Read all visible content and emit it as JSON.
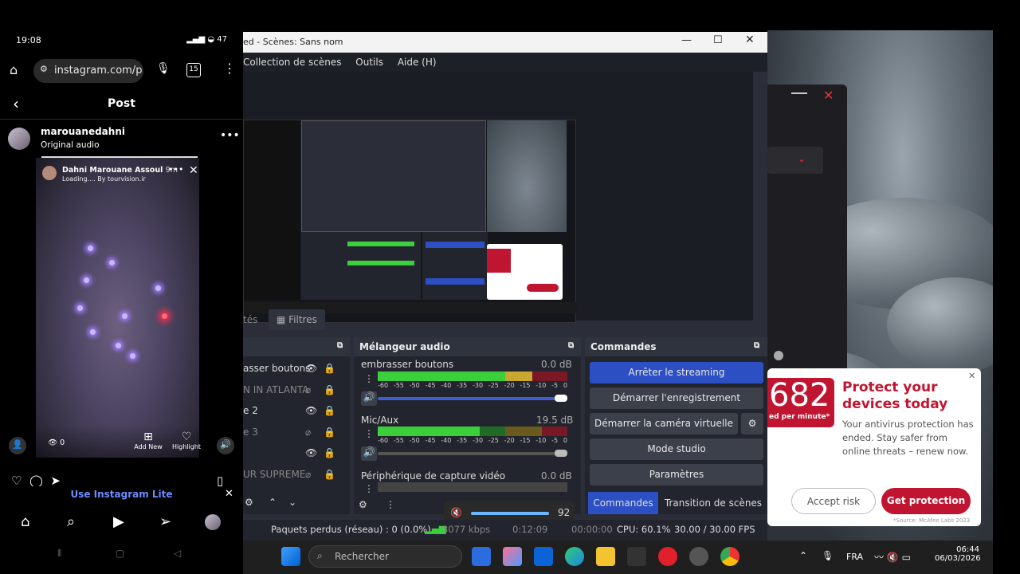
{
  "phone": {
    "time": "19:08",
    "url": "instagram.com/p.",
    "tab_count": "15",
    "page_title": "Post",
    "username": "marouanedahni",
    "audio": "Original audio",
    "story_user": "Dahni Marouane Assoul",
    "story_time": "9m",
    "story_sub": "Loading.... By tourvision.ir",
    "views": "0",
    "add_new": "Add New",
    "highlight": "Highlight",
    "lite_banner": "Use Instagram Lite"
  },
  "obs": {
    "title": "ed - Scènes: Sans nom",
    "menu": [
      "Collection de scènes",
      "Outils",
      "Aide (H)"
    ],
    "tabs": {
      "props": "tés",
      "filters": "Filtres"
    },
    "sources": {
      "items": [
        "asser boutons",
        "N IN ATLANTA",
        "e 2",
        "e 3",
        "",
        "UR SUPREME"
      ]
    },
    "mixer": {
      "title": "Mélangeur audio",
      "channels": [
        {
          "name": "embrasser boutons",
          "db": "0.0 dB",
          "level": 0.95,
          "volume": 1.0
        },
        {
          "name": "Mic/Aux",
          "db": "19.5 dB",
          "level": 0.86,
          "volume": 1.0
        },
        {
          "name": "Périphérique de capture vidéo",
          "db": "0.0 dB",
          "level": 0.0,
          "volume": 1.0
        }
      ],
      "scale": [
        "-60",
        "-55",
        "-50",
        "-45",
        "-40",
        "-35",
        "-30",
        "-25",
        "-20",
        "-15",
        "-10",
        "-5",
        "0"
      ]
    },
    "controls": {
      "title": "Commandes",
      "buttons": [
        "Arrêter le streaming",
        "Démarrer l'enregistrement",
        "Démarrer la caméra virtuelle",
        "Mode studio",
        "Paramètres"
      ],
      "tabs": [
        "Commandes",
        "Transition de scènes"
      ]
    },
    "volume_popup": {
      "value": "92"
    },
    "status": {
      "dropped": "Paquets perdus (réseau) : 0 (0.0%)",
      "bitrate": "3077 kbps",
      "stream_time": "0:12:09",
      "rec_time": "00:00:00",
      "cpu": "CPU: 60.1%",
      "fps": "30.00 / 30.00 FPS"
    }
  },
  "mcafee": {
    "big_number": "682",
    "big_sub": "ed per minute*",
    "title": "Protect your devices today",
    "body": "Your antivirus protection has ended. Stay safer from online threats – renew now.",
    "accept": "Accept risk",
    "protect": "Get protection",
    "source": "*Source: McAfee Labs 2023"
  },
  "taskbar": {
    "search_placeholder": "Rechercher",
    "lang": "FRA",
    "time": "06:44",
    "date": "06/03/2026"
  },
  "colors": {
    "accent_blue": "#2c4fc4",
    "mcafee_red": "#c01530",
    "meter_green": "#3ccf3c",
    "meter_yellow": "#c9a82e",
    "meter_red": "#c0243a"
  }
}
